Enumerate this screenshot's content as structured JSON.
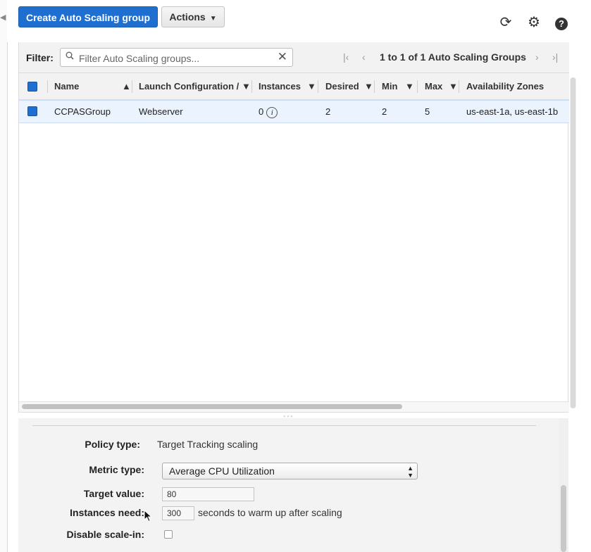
{
  "toolbar": {
    "create_label": "Create Auto Scaling group",
    "actions_label": "Actions",
    "refresh_icon": "refresh-icon",
    "settings_icon": "gear-icon",
    "help_icon": "help-icon",
    "help_glyph": "?"
  },
  "filter": {
    "label": "Filter:",
    "placeholder": "Filter Auto Scaling groups...",
    "value": ""
  },
  "pager": {
    "text": "1 to 1 of 1 Auto Scaling Groups"
  },
  "table": {
    "columns": [
      "Name",
      "Launch Configuration /",
      "Instances",
      "Desired",
      "Min",
      "Max",
      "Availability Zones"
    ],
    "rows": [
      {
        "name": "CCPASGroup",
        "launch_config": "Webserver",
        "instances": "0",
        "desired": "2",
        "min": "2",
        "max": "5",
        "zones": "us-east-1a, us-east-1b"
      }
    ]
  },
  "policy": {
    "policy_type_label": "Policy type:",
    "policy_type_value": "Target Tracking scaling",
    "metric_type_label": "Metric type:",
    "metric_type_value": "Average CPU Utilization",
    "target_value_label": "Target value:",
    "target_value": "80",
    "instances_need_label": "Instances need:",
    "warmup_value": "300",
    "warmup_suffix": "seconds to warm up after scaling",
    "disable_scale_in_label": "Disable scale-in:",
    "disable_scale_in_checked": false
  },
  "colors": {
    "primary": "#1f6fd1",
    "selected_row": "#eaf3fe"
  }
}
